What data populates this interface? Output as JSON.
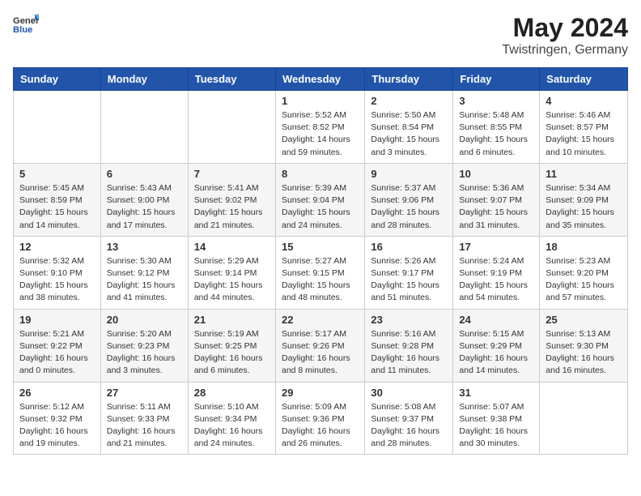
{
  "header": {
    "logo_general": "General",
    "logo_blue": "Blue",
    "month": "May 2024",
    "location": "Twistringen, Germany"
  },
  "weekdays": [
    "Sunday",
    "Monday",
    "Tuesday",
    "Wednesday",
    "Thursday",
    "Friday",
    "Saturday"
  ],
  "weeks": [
    [
      {
        "day": "",
        "info": ""
      },
      {
        "day": "",
        "info": ""
      },
      {
        "day": "",
        "info": ""
      },
      {
        "day": "1",
        "info": "Sunrise: 5:52 AM\nSunset: 8:52 PM\nDaylight: 14 hours\nand 59 minutes."
      },
      {
        "day": "2",
        "info": "Sunrise: 5:50 AM\nSunset: 8:54 PM\nDaylight: 15 hours\nand 3 minutes."
      },
      {
        "day": "3",
        "info": "Sunrise: 5:48 AM\nSunset: 8:55 PM\nDaylight: 15 hours\nand 6 minutes."
      },
      {
        "day": "4",
        "info": "Sunrise: 5:46 AM\nSunset: 8:57 PM\nDaylight: 15 hours\nand 10 minutes."
      }
    ],
    [
      {
        "day": "5",
        "info": "Sunrise: 5:45 AM\nSunset: 8:59 PM\nDaylight: 15 hours\nand 14 minutes."
      },
      {
        "day": "6",
        "info": "Sunrise: 5:43 AM\nSunset: 9:00 PM\nDaylight: 15 hours\nand 17 minutes."
      },
      {
        "day": "7",
        "info": "Sunrise: 5:41 AM\nSunset: 9:02 PM\nDaylight: 15 hours\nand 21 minutes."
      },
      {
        "day": "8",
        "info": "Sunrise: 5:39 AM\nSunset: 9:04 PM\nDaylight: 15 hours\nand 24 minutes."
      },
      {
        "day": "9",
        "info": "Sunrise: 5:37 AM\nSunset: 9:06 PM\nDaylight: 15 hours\nand 28 minutes."
      },
      {
        "day": "10",
        "info": "Sunrise: 5:36 AM\nSunset: 9:07 PM\nDaylight: 15 hours\nand 31 minutes."
      },
      {
        "day": "11",
        "info": "Sunrise: 5:34 AM\nSunset: 9:09 PM\nDaylight: 15 hours\nand 35 minutes."
      }
    ],
    [
      {
        "day": "12",
        "info": "Sunrise: 5:32 AM\nSunset: 9:10 PM\nDaylight: 15 hours\nand 38 minutes."
      },
      {
        "day": "13",
        "info": "Sunrise: 5:30 AM\nSunset: 9:12 PM\nDaylight: 15 hours\nand 41 minutes."
      },
      {
        "day": "14",
        "info": "Sunrise: 5:29 AM\nSunset: 9:14 PM\nDaylight: 15 hours\nand 44 minutes."
      },
      {
        "day": "15",
        "info": "Sunrise: 5:27 AM\nSunset: 9:15 PM\nDaylight: 15 hours\nand 48 minutes."
      },
      {
        "day": "16",
        "info": "Sunrise: 5:26 AM\nSunset: 9:17 PM\nDaylight: 15 hours\nand 51 minutes."
      },
      {
        "day": "17",
        "info": "Sunrise: 5:24 AM\nSunset: 9:19 PM\nDaylight: 15 hours\nand 54 minutes."
      },
      {
        "day": "18",
        "info": "Sunrise: 5:23 AM\nSunset: 9:20 PM\nDaylight: 15 hours\nand 57 minutes."
      }
    ],
    [
      {
        "day": "19",
        "info": "Sunrise: 5:21 AM\nSunset: 9:22 PM\nDaylight: 16 hours\nand 0 minutes."
      },
      {
        "day": "20",
        "info": "Sunrise: 5:20 AM\nSunset: 9:23 PM\nDaylight: 16 hours\nand 3 minutes."
      },
      {
        "day": "21",
        "info": "Sunrise: 5:19 AM\nSunset: 9:25 PM\nDaylight: 16 hours\nand 6 minutes."
      },
      {
        "day": "22",
        "info": "Sunrise: 5:17 AM\nSunset: 9:26 PM\nDaylight: 16 hours\nand 8 minutes."
      },
      {
        "day": "23",
        "info": "Sunrise: 5:16 AM\nSunset: 9:28 PM\nDaylight: 16 hours\nand 11 minutes."
      },
      {
        "day": "24",
        "info": "Sunrise: 5:15 AM\nSunset: 9:29 PM\nDaylight: 16 hours\nand 14 minutes."
      },
      {
        "day": "25",
        "info": "Sunrise: 5:13 AM\nSunset: 9:30 PM\nDaylight: 16 hours\nand 16 minutes."
      }
    ],
    [
      {
        "day": "26",
        "info": "Sunrise: 5:12 AM\nSunset: 9:32 PM\nDaylight: 16 hours\nand 19 minutes."
      },
      {
        "day": "27",
        "info": "Sunrise: 5:11 AM\nSunset: 9:33 PM\nDaylight: 16 hours\nand 21 minutes."
      },
      {
        "day": "28",
        "info": "Sunrise: 5:10 AM\nSunset: 9:34 PM\nDaylight: 16 hours\nand 24 minutes."
      },
      {
        "day": "29",
        "info": "Sunrise: 5:09 AM\nSunset: 9:36 PM\nDaylight: 16 hours\nand 26 minutes."
      },
      {
        "day": "30",
        "info": "Sunrise: 5:08 AM\nSunset: 9:37 PM\nDaylight: 16 hours\nand 28 minutes."
      },
      {
        "day": "31",
        "info": "Sunrise: 5:07 AM\nSunset: 9:38 PM\nDaylight: 16 hours\nand 30 minutes."
      },
      {
        "day": "",
        "info": ""
      }
    ]
  ]
}
